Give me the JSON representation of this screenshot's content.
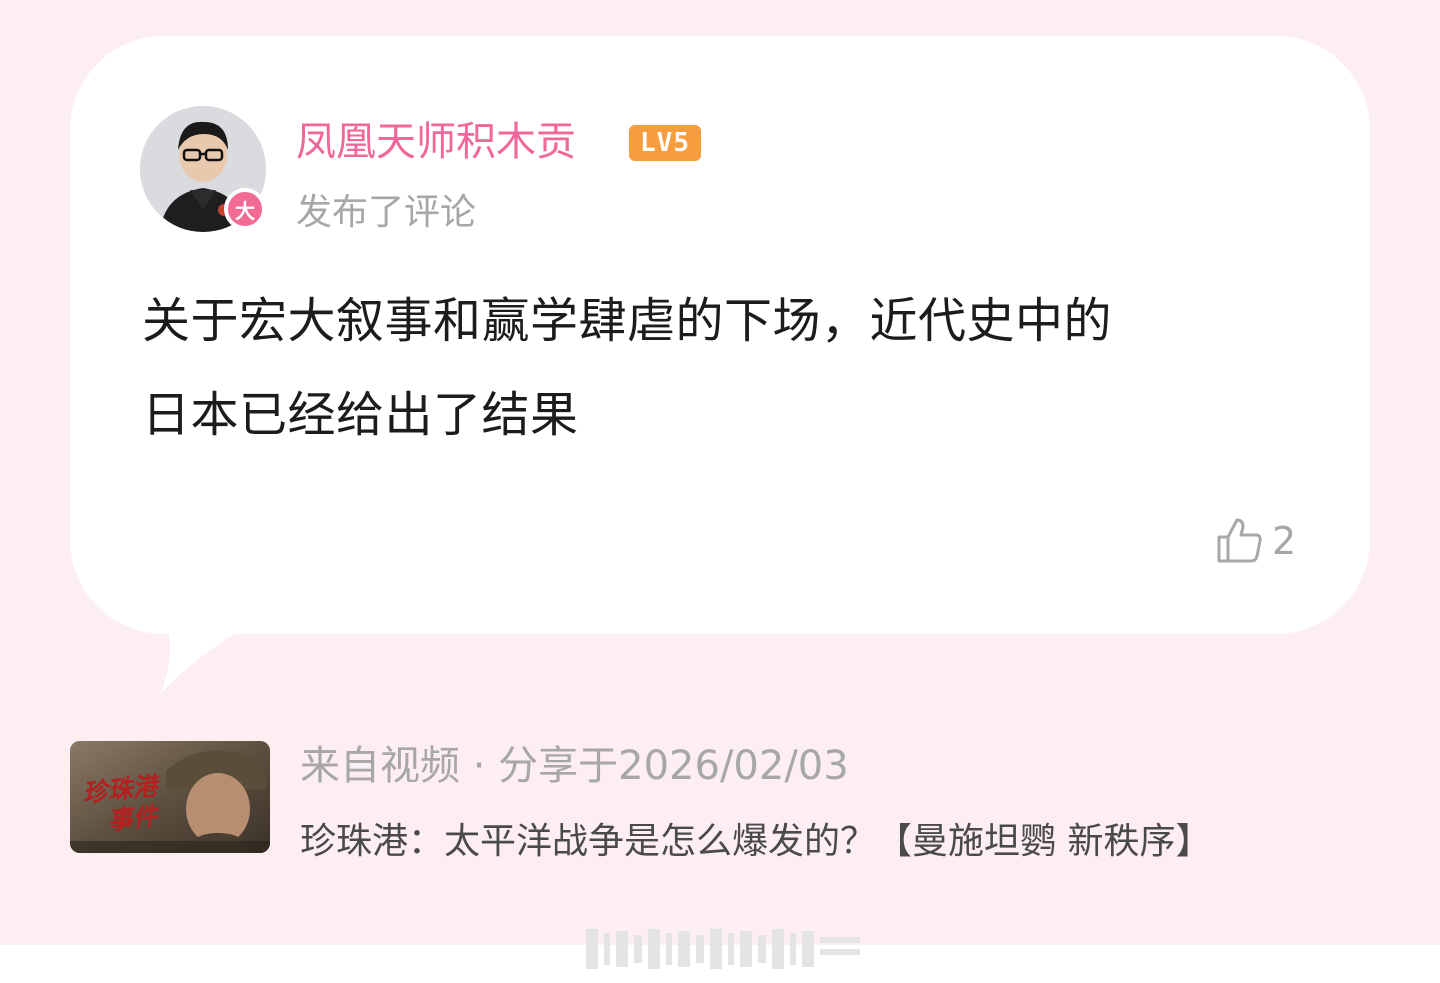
{
  "post": {
    "username": "凤凰天师积木贡",
    "level": "LV5",
    "user_badge": "大",
    "action": "发布了评论",
    "comment_line1": "关于宏大叙事和赢学肆虐的下场，近代史中的",
    "comment_line2": "日本已经给出了结果",
    "like_count": "2"
  },
  "source": {
    "meta": "来自视频 · 分享于2026/02/03",
    "title": "珍珠港：太平洋战争是怎么爆发的？【曼施坦鹦 新秩序】",
    "thumbnail_title_line1": "珍珠港",
    "thumbnail_title_line2": "事件"
  },
  "colors": {
    "background": "#fdeef1",
    "bubble": "#ffffff",
    "username": "#f0679a",
    "level_badge": "#f79d3e",
    "user_badge": "#f26b95",
    "muted_text": "#a7a7a7",
    "body_text": "#1c1c1c"
  },
  "icons": {
    "like": "thumbs-up-icon"
  }
}
